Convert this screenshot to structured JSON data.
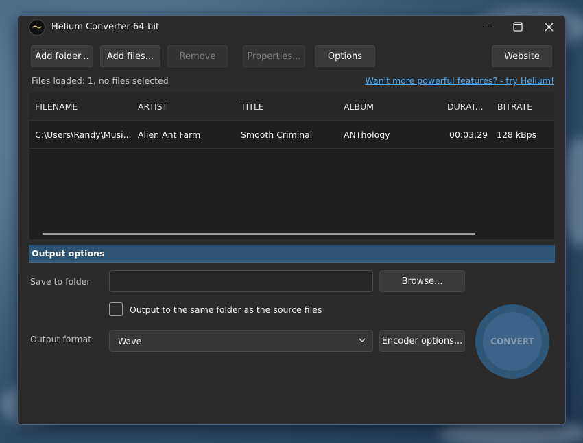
{
  "window": {
    "title": "Helium Converter 64-bit",
    "logo_glyph": "〜",
    "controls": [
      "minimize-icon",
      "maximize-icon",
      "close-icon"
    ]
  },
  "toolbar": {
    "add_folder": "Add folder...",
    "add_files": "Add files...",
    "remove": "Remove",
    "properties": "Properties...",
    "options": "Options",
    "website": "Website"
  },
  "status": {
    "files_loaded": "Files loaded: 1, no files selected",
    "promo_link": "Wan't more powerful features? - try Helium!"
  },
  "table": {
    "columns": [
      "FILENAME",
      "ARTIST",
      "TITLE",
      "ALBUM",
      "DURAT...",
      "BITRATE"
    ],
    "rows": [
      [
        "C:\\Users\\Randy\\Musi...",
        "Alien Ant Farm",
        "Smooth Criminal",
        "ANThology",
        "00:03:29",
        "128 kBps"
      ]
    ]
  },
  "output": {
    "section_title": "Output options",
    "save_to_folder_label": "Save to folder",
    "save_to_folder_value": "",
    "browse": "Browse...",
    "same_folder_label": "Output to the same folder as the source files",
    "same_folder_checked": false,
    "format_label": "Output format:",
    "format_value": "Wave",
    "encoder_options": "Encoder options...",
    "convert": "CONVERT"
  },
  "colors": {
    "accent": "#2e5476",
    "link": "#4aa3ea",
    "window_bg": "#2b2b2b",
    "list_bg": "#1f1f1f"
  }
}
